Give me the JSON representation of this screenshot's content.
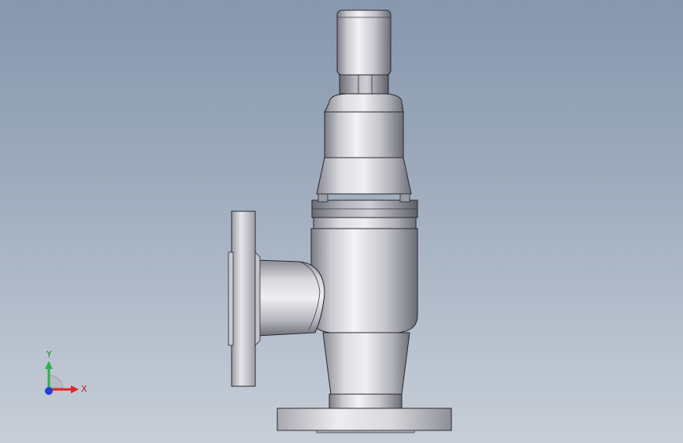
{
  "viewport": {
    "background_top": "#8797ad",
    "background_bottom": "#c7ced8"
  },
  "model": {
    "metal_light": "#f2f2f4",
    "metal_mid": "#b9b9c0",
    "metal_dark": "#6e6e78",
    "edge": "#2a2a30"
  },
  "triad": {
    "x_label": "X",
    "y_label": "Y",
    "x_color": "#e0232b",
    "y_color": "#29b34a",
    "z_color": "#1f3fd6"
  }
}
